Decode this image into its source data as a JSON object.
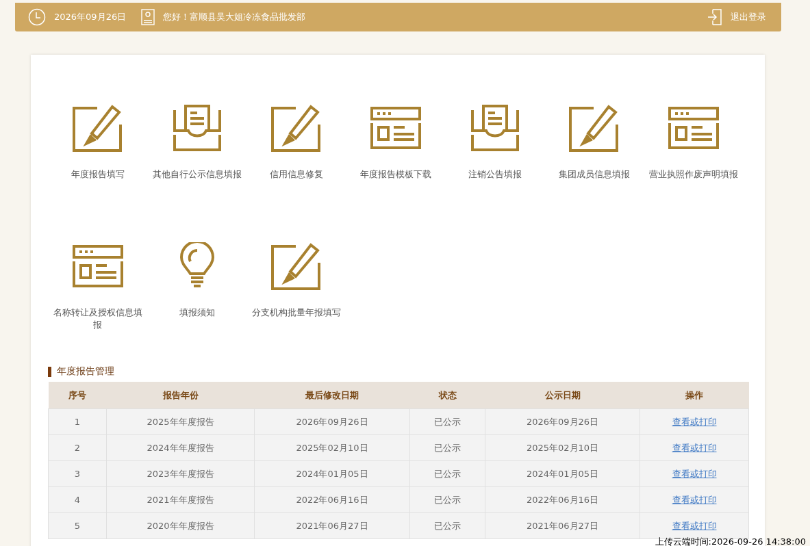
{
  "top_bar": {
    "date": "2026年09月26日",
    "greeting": "您好！富顺县吴大姐冷冻食品批发部",
    "logout": "退出登录"
  },
  "tiles": [
    {
      "kind": "edit",
      "label": "年度报告填写"
    },
    {
      "kind": "tray",
      "label": "其他自行公示信息填报"
    },
    {
      "kind": "edit",
      "label": "信用信息修复"
    },
    {
      "kind": "window",
      "label": "年度报告模板下载"
    },
    {
      "kind": "tray",
      "label": "注销公告填报"
    },
    {
      "kind": "edit",
      "label": "集团成员信息填报"
    },
    {
      "kind": "window",
      "label": "营业执照作废声明填报"
    },
    {
      "kind": "window",
      "label": "名称转让及授权信息填报"
    },
    {
      "kind": "bulb",
      "label": "填报须知"
    },
    {
      "kind": "edit",
      "label": "分支机构批量年报填写"
    }
  ],
  "section_title": "年度报告管理",
  "table": {
    "columns": [
      "序号",
      "报告年份",
      "最后修改日期",
      "状态",
      "公示日期",
      "操作"
    ],
    "rows": [
      [
        "1",
        "2025年年度报告",
        "2026年09月26日",
        "已公示",
        "2026年09月26日",
        "查看或打印"
      ],
      [
        "2",
        "2024年年度报告",
        "2025年02月10日",
        "已公示",
        "2025年02月10日",
        "查看或打印"
      ],
      [
        "3",
        "2023年年度报告",
        "2024年01月05日",
        "已公示",
        "2024年01月05日",
        "查看或打印"
      ],
      [
        "4",
        "2021年年度报告",
        "2022年06月16日",
        "已公示",
        "2022年06月16日",
        "查看或打印"
      ],
      [
        "5",
        "2020年年度报告",
        "2021年06月27日",
        "已公示",
        "2021年06月27日",
        "查看或打印"
      ]
    ]
  },
  "upload_time": "上传云端时间:2026-09-26 14:38:00"
}
